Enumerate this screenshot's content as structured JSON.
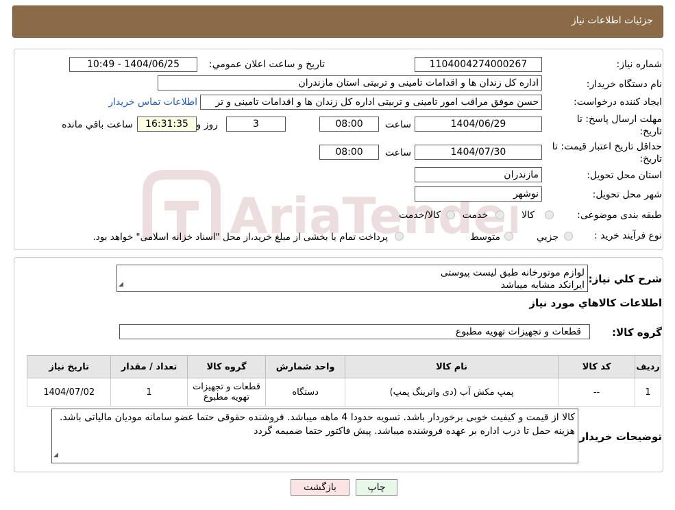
{
  "header": {
    "title": "جزئیات اطلاعات نیاز"
  },
  "watermark": {
    "text": "AriaTender.neT"
  },
  "form": {
    "need_number_label": "شماره نیاز:",
    "need_number": "1104004274000267",
    "announce_label": "تاریخ و ساعت اعلان عمومي:",
    "announce_value": "1404/06/25 - 10:49",
    "buyer_org_label": "نام دستگاه خريدار:",
    "buyer_org": "اداره کل زندان ها و اقدامات تامینی و تربیتی استان مازندران",
    "requester_label": "ايجاد کننده درخواست:",
    "requester": "حسن موفق مراقب امور تامینی و تربیتی اداره کل زندان ها و اقدامات تامینی و تر",
    "contact_link": "اطلاعات تماس خريدار",
    "deadline_label_1": "مهلت ارسال پاسخ: تا",
    "deadline_label_2": "تاريخ:",
    "deadline_date": "1404/06/29",
    "time_label": "ساعت",
    "deadline_time": "08:00",
    "days_value": "3",
    "days_label": "روز و",
    "remaining_value": "16:31:35",
    "remaining_label": "ساعت باقي مانده",
    "validity_label_1": "حداقل تاريخ اعتبار قيمت: تا",
    "validity_label_2": "تاريخ:",
    "validity_date": "1404/07/30",
    "validity_time_label": "ساعت",
    "validity_time": "08:00",
    "province_label": "استان محل تحويل:",
    "province": "مازندران",
    "city_label": "شهر محل تحويل:",
    "city": "نوشهر",
    "category_label": "طبقه بندی موضوعی:",
    "category_options": [
      "کالا",
      "خدمت",
      "کالا/خدمت"
    ],
    "process_label": "نوع فرآيند خريد :",
    "process_options": [
      "جزيي",
      "متوسط"
    ],
    "process_note": "پرداخت تمام يا بخشی از مبلغ خريد،از محل \"اسناد خزانه اسلامی\" خواهد بود."
  },
  "description": {
    "label": "شرح کلي نياز:",
    "line1": "لوازم موتورخانه طبق لیست پیوستی",
    "line2": "ایرانکد مشابه میباشد"
  },
  "goods": {
    "section_title": "اطلاعات کالاهاي مورد نياز",
    "group_label": "گروه کالا:",
    "group_value": "قطعات و تجهیزات تهویه مطبوع",
    "columns": [
      "رديف",
      "کد کالا",
      "نام کالا",
      "واحد شمارش",
      "گروه کالا",
      "تعداد / مقدار",
      "تاريخ نياز"
    ],
    "rows": [
      [
        "1",
        "--",
        "پمپ مکش آب (دی واترینگ پمپ)",
        "دستگاه",
        "قطعات و تجهیزات تهویه مطبوع",
        "1",
        "1404/07/02"
      ]
    ]
  },
  "buyer_notes": {
    "label": "توضيحات خريدار:",
    "text": "کالا از قیمت و کیفیت خوبی برخوردار باشد. تسویه حدودا 4 ماهه میباشد. فروشنده حقوقی حتما عضو سامانه مودیان مالیاتی باشد. هزینه حمل تا درب اداره بر عهده فروشنده میباشد. پیش فاکتور حتما ضمیمه گردد"
  },
  "buttons": {
    "print": "چاپ",
    "back": "بازگشت"
  },
  "colors": {
    "header_bg": "#8b6a48",
    "link": "#1f5bd1",
    "back_btn": "#fde4e4",
    "print_btn": "#e8f8e8"
  }
}
